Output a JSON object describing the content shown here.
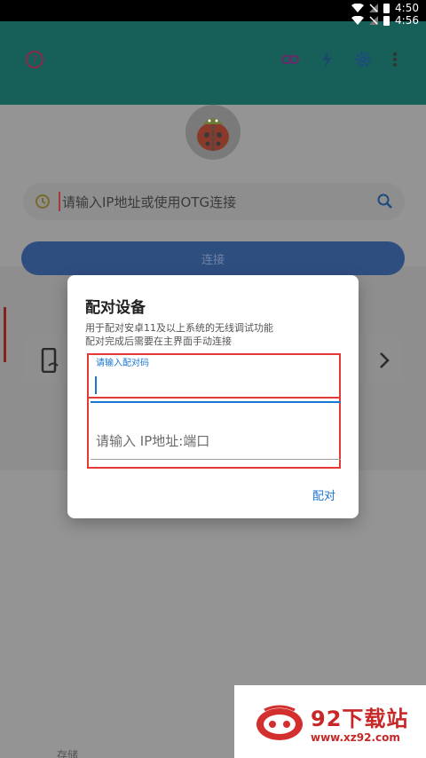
{
  "status_bar": {
    "time_top": "4:50",
    "time_second": "4:56"
  },
  "toolbar": {
    "icons": [
      "help-icon",
      "link-icon",
      "flash-icon",
      "settings-icon",
      "more-icon"
    ]
  },
  "search": {
    "placeholder": "请输入IP地址或使用OTG连接"
  },
  "connect_button": {
    "label": "连接"
  },
  "dialog": {
    "title": "配对设备",
    "description_line1": "用于配对安卓11及以上系统的无线调试功能",
    "description_line2": "配对完成后需要在主界面手动连接",
    "code_field_label": "请输入配对码",
    "ip_field_placeholder": "请输入 IP地址:端口",
    "pair_button": "配对"
  },
  "watermark": {
    "title": "92下载站",
    "url": "www.xz92.com"
  },
  "colors": {
    "accent": "#1976d2",
    "highlight_red": "#e53935",
    "appbar": "#26a69a"
  },
  "bottom": {
    "text": "存储"
  }
}
